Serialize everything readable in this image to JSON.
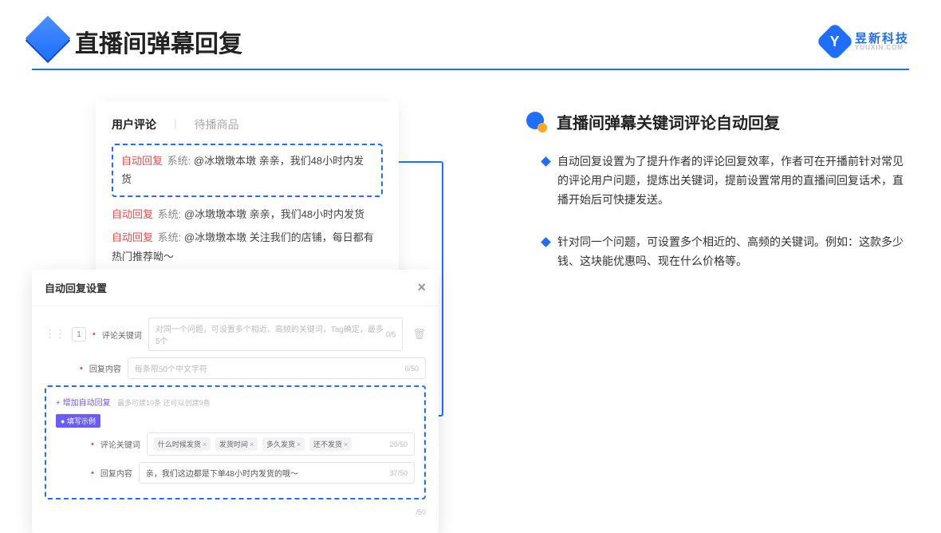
{
  "header": {
    "title": "直播间弹幕回复",
    "logo_cn": "昱新科技",
    "logo_en": "YUUXIN.COM",
    "logo_letter": "Y"
  },
  "card1": {
    "tab_active": "用户评论",
    "tab_inactive": "待播商品",
    "msg1_tag": "自动回复",
    "msg1_sys": "系统:",
    "msg1_text": "@冰墩墩本墩 亲亲，我们48小时内发货",
    "msg2_tag": "自动回复",
    "msg2_sys": "系统:",
    "msg2_text": "@冰墩墩本墩 亲亲，我们48小时内发货",
    "msg3_tag": "自动回复",
    "msg3_sys": "系统:",
    "msg3_text": "@冰墩墩本墩 关注我们的店铺，每日都有热门推荐呦～"
  },
  "card2": {
    "title": "自动回复设置",
    "close": "×",
    "idx": "1",
    "label_keyword": "评论关键词",
    "placeholder_keyword": "对同一个问题，可设置多个相近、高频的关键词，Tag确定，最多5个",
    "count_keyword": "0/5",
    "label_content": "回复内容",
    "placeholder_content": "每条限50个中文字符",
    "count_content": "0/50",
    "add_link": "+ 增加自动回复",
    "add_info": "最多可建10条 还可以创建9条",
    "example_badge": "● 填写示例",
    "ex_label_keyword": "评论关键词",
    "chip1": "什么时候发货",
    "chip2": "发货时间",
    "chip3": "多久发货",
    "chip4": "还不发货",
    "count_ex_keyword": "20/50",
    "ex_label_content": "回复内容",
    "ex_content_value": "亲，我们这边都是下单48小时内发货的哦～",
    "count_ex_content": "37/50",
    "outer_count": "/50"
  },
  "right": {
    "title": "直播间弹幕关键词评论自动回复",
    "bullet1": "自动回复设置为了提升作者的评论回复效率，作者可在开播前针对常见的评论用户问题，提炼出关键词，提前设置常用的直播间回复话术，直播开始后可快捷发送。",
    "bullet2": "针对同一个问题，可设置多个相近的、高频的关键词。例如：这款多少钱、这块能优惠吗、现在什么价格等。"
  }
}
